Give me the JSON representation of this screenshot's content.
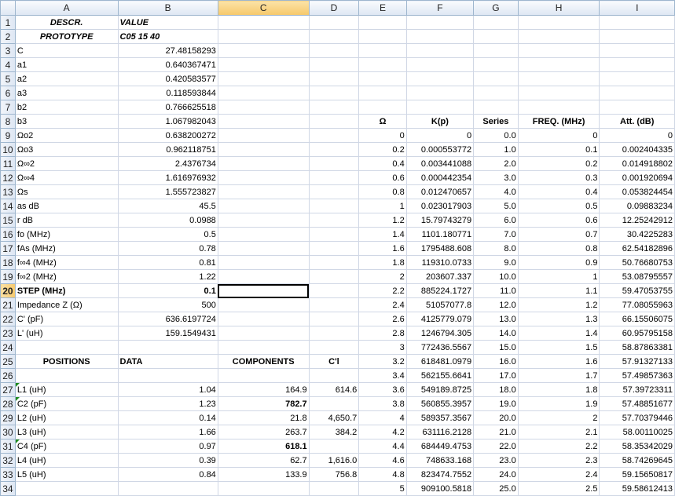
{
  "columns": [
    "A",
    "B",
    "C",
    "D",
    "E",
    "F",
    "G",
    "H",
    "I"
  ],
  "selected_column": "C",
  "selected_row": 20,
  "rows": [
    {
      "n": 1,
      "cells": [
        "DESCR.",
        "VALUE",
        "",
        "",
        "",
        "",
        "",
        "",
        ""
      ]
    },
    {
      "n": 2,
      "cells": [
        "PROTOTYPE",
        "C05 15 40",
        "",
        "",
        "",
        "",
        "",
        "",
        ""
      ]
    },
    {
      "n": 3,
      "cells": [
        "C",
        "27.48158293",
        "",
        "",
        "",
        "",
        "",
        "",
        ""
      ]
    },
    {
      "n": 4,
      "cells": [
        "a1",
        "0.640367471",
        "",
        "",
        "",
        "",
        "",
        "",
        ""
      ]
    },
    {
      "n": 5,
      "cells": [
        "a2",
        "0.420583577",
        "",
        "",
        "",
        "",
        "",
        "",
        ""
      ]
    },
    {
      "n": 6,
      "cells": [
        "a3",
        "0.118593844",
        "",
        "",
        "",
        "",
        "",
        "",
        ""
      ]
    },
    {
      "n": 7,
      "cells": [
        "b2",
        "0.766625518",
        "",
        "",
        "",
        "",
        "",
        "",
        ""
      ]
    },
    {
      "n": 8,
      "cells": [
        "b3",
        "1.067982043",
        "",
        "",
        "Ω",
        "K(p)",
        "Series",
        "FREQ. (MHz)",
        "Att. (dB)"
      ]
    },
    {
      "n": 9,
      "cells": [
        "Ωo2",
        "0.638200272",
        "",
        "",
        "0",
        "0",
        "0.0",
        "0",
        "0"
      ]
    },
    {
      "n": 10,
      "cells": [
        "Ωo3",
        "0.962118751",
        "",
        "",
        "0.2",
        "0.000553772",
        "1.0",
        "0.1",
        "0.002404335"
      ]
    },
    {
      "n": 11,
      "cells": [
        "Ω∞2",
        "2.4376734",
        "",
        "",
        "0.4",
        "0.003441088",
        "2.0",
        "0.2",
        "0.014918802"
      ]
    },
    {
      "n": 12,
      "cells": [
        "Ω∞4",
        "1.616976932",
        "",
        "",
        "0.6",
        "0.000442354",
        "3.0",
        "0.3",
        "0.001920694"
      ]
    },
    {
      "n": 13,
      "cells": [
        "Ωs",
        "1.555723827",
        "",
        "",
        "0.8",
        "0.012470657",
        "4.0",
        "0.4",
        "0.053824454"
      ]
    },
    {
      "n": 14,
      "cells": [
        "as dB",
        "45.5",
        "",
        "",
        "1",
        "0.023017903",
        "5.0",
        "0.5",
        "0.09883234"
      ]
    },
    {
      "n": 15,
      "cells": [
        "r dB",
        "0.0988",
        "",
        "",
        "1.2",
        "15.79743279",
        "6.0",
        "0.6",
        "12.25242912"
      ]
    },
    {
      "n": 16,
      "cells": [
        "fo (MHz)",
        "0.5",
        "",
        "",
        "1.4",
        "1101.180771",
        "7.0",
        "0.7",
        "30.4225283"
      ]
    },
    {
      "n": 17,
      "cells": [
        "fAs (MHz)",
        "0.78",
        "",
        "",
        "1.6",
        "1795488.608",
        "8.0",
        "0.8",
        "62.54182896"
      ]
    },
    {
      "n": 18,
      "cells": [
        "f∞4 (MHz)",
        "0.81",
        "",
        "",
        "1.8",
        "119310.0733",
        "9.0",
        "0.9",
        "50.76680753"
      ]
    },
    {
      "n": 19,
      "cells": [
        "f∞2 (MHz)",
        "1.22",
        "",
        "",
        "2",
        "203607.337",
        "10.0",
        "1",
        "53.08795557"
      ]
    },
    {
      "n": 20,
      "cells": [
        "STEP (MHz)",
        "0.1",
        "",
        "",
        "2.2",
        "885224.1727",
        "11.0",
        "1.1",
        "59.47053755"
      ]
    },
    {
      "n": 21,
      "cells": [
        "Impedance Z (Ω)",
        "500",
        "",
        "",
        "2.4",
        "51057077.8",
        "12.0",
        "1.2",
        "77.08055963"
      ]
    },
    {
      "n": 22,
      "cells": [
        "C'   (pF)",
        "636.6197724",
        "",
        "",
        "2.6",
        "4125779.079",
        "13.0",
        "1.3",
        "66.15506075"
      ]
    },
    {
      "n": 23,
      "cells": [
        "L'   (uH)",
        "159.1549431",
        "",
        "",
        "2.8",
        "1246794.305",
        "14.0",
        "1.4",
        "60.95795158"
      ]
    },
    {
      "n": 24,
      "cells": [
        "",
        "",
        "",
        "",
        "3",
        "772436.5567",
        "15.0",
        "1.5",
        "58.87863381"
      ]
    },
    {
      "n": 25,
      "cells": [
        "POSITIONS",
        "DATA",
        "COMPONENTS",
        "C'l",
        "3.2",
        "618481.0979",
        "16.0",
        "1.6",
        "57.91327133"
      ]
    },
    {
      "n": 26,
      "cells": [
        "",
        "",
        "",
        "",
        "3.4",
        "562155.6641",
        "17.0",
        "1.7",
        "57.49857363"
      ]
    },
    {
      "n": 27,
      "cells": [
        "L1 (uH)",
        "1.04",
        "164.9",
        "614.6",
        "3.6",
        "549189.8725",
        "18.0",
        "1.8",
        "57.39723311"
      ]
    },
    {
      "n": 28,
      "cells": [
        "C2 (pF)",
        "1.23",
        "782.7",
        "",
        "3.8",
        "560855.3957",
        "19.0",
        "1.9",
        "57.48851677"
      ]
    },
    {
      "n": 29,
      "cells": [
        "L2 (uH)",
        "0.14",
        "21.8",
        "4,650.7",
        "4",
        "589357.3567",
        "20.0",
        "2",
        "57.70379446"
      ]
    },
    {
      "n": 30,
      "cells": [
        "L3 (uH)",
        "1.66",
        "263.7",
        "384.2",
        "4.2",
        "631116.2128",
        "21.0",
        "2.1",
        "58.00110025"
      ]
    },
    {
      "n": 31,
      "cells": [
        "C4 (pF)",
        "0.97",
        "618.1",
        "",
        "4.4",
        "684449.4753",
        "22.0",
        "2.2",
        "58.35342029"
      ]
    },
    {
      "n": 32,
      "cells": [
        "L4 (uH)",
        "0.39",
        "62.7",
        "1,616.0",
        "4.6",
        "748633.168",
        "23.0",
        "2.3",
        "58.74269645"
      ]
    },
    {
      "n": 33,
      "cells": [
        "L5 (uH)",
        "0.84",
        "133.9",
        "756.8",
        "4.8",
        "823474.7552",
        "24.0",
        "2.4",
        "59.15650817"
      ]
    },
    {
      "n": 34,
      "cells": [
        "",
        "",
        "",
        "",
        "5",
        "909100.5818",
        "25.0",
        "2.5",
        "59.58612413"
      ]
    }
  ]
}
